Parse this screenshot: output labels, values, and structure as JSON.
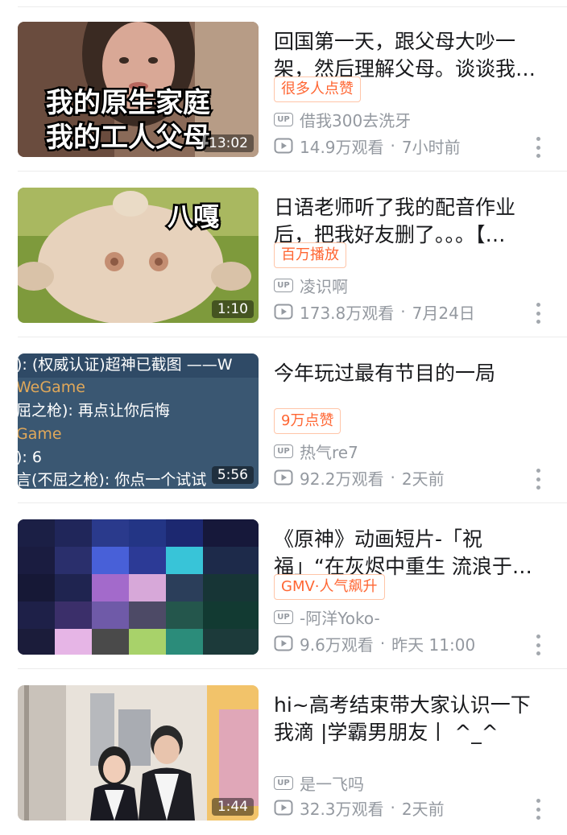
{
  "feed": {
    "items": [
      {
        "title": "回国第一天，跟父母大吵一架，然后理解父母。谈谈我…",
        "badge": "很多人点赞",
        "uploader": "借我300去洗牙",
        "views": "14.9万观看",
        "time": "7小时前",
        "duration": "13:02",
        "thumb_text": [
          "我的原生家庭",
          "我的工人父母"
        ]
      },
      {
        "title": "日语老师听了我的配音作业后，把我好友删了。。。【…",
        "badge": "百万播放",
        "uploader": "凌识啊",
        "views": "173.8万观看",
        "time": "7月24日",
        "duration": "1:10",
        "thumb_text": [
          "八嘎"
        ]
      },
      {
        "title": "今年玩过最有节目的一局",
        "badge": "9万点赞",
        "uploader": "热气re7",
        "views": "92.2万观看",
        "time": "2天前",
        "duration": "5:56",
        "thumb_text": [
          "): (权威认证)超神已截图 ——W",
          "WeGame",
          "屈之枪): 再点让你后悔",
          "Game",
          "): 6",
          "言(不屈之枪): 你点一个试试"
        ]
      },
      {
        "title": "《原神》动画短片-「祝福」“在灰烬中重生 流浪于浮世…",
        "badge": "GMV·人气飙升",
        "uploader": "-阿洋Yoko-",
        "views": "9.6万观看",
        "time": "昨天 11:00",
        "duration": "",
        "thumb_text": []
      },
      {
        "title": "hi~高考结束带大家认识一下我滴 |学霸男朋友丨 ^_^",
        "badge": "",
        "uploader": "是一飞吗",
        "views": "32.3万观看",
        "time": "2天前",
        "duration": "1:44",
        "thumb_text": []
      }
    ],
    "up_label": "UP",
    "separator": "·"
  },
  "colors": {
    "badge_text": "#ff6633",
    "badge_border": "#ffc5a8",
    "meta_gray": "#9499a0",
    "title": "#18191c"
  },
  "icons": {
    "up": "up-icon",
    "views": "play-icon",
    "more": "more-vertical-icon"
  }
}
